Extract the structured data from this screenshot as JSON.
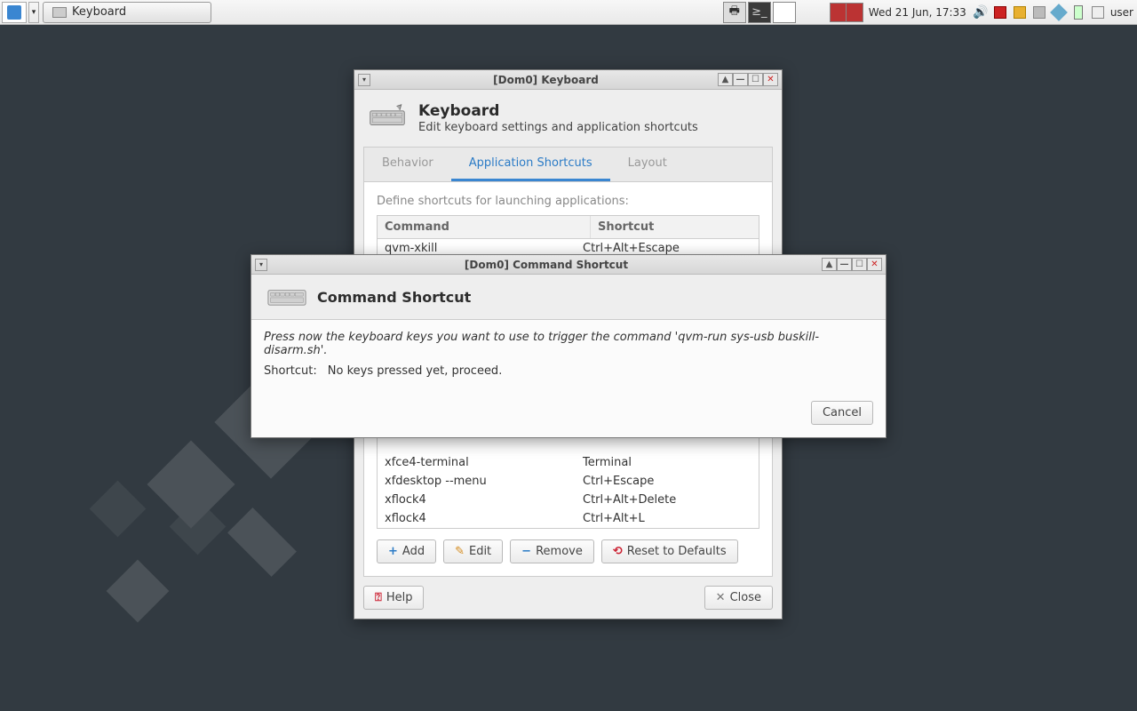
{
  "taskbar": {
    "task_label": "Keyboard",
    "clock": "Wed 21 Jun, 17:33",
    "username": "user"
  },
  "kbd_window": {
    "title": "[Dom0] Keyboard",
    "header_title": "Keyboard",
    "header_sub": "Edit keyboard settings and application shortcuts",
    "tabs": {
      "behavior": "Behavior",
      "app_shortcuts": "Application Shortcuts",
      "layout": "Layout"
    },
    "intro": "Define shortcuts for launching applications:",
    "th_command": "Command",
    "th_shortcut": "Shortcut",
    "rows_top": [
      {
        "cmd": "qvm-xkill",
        "sh": "Ctrl+Alt+Escape"
      }
    ],
    "rows_bottom": [
      {
        "cmd": "xfce4-terminal",
        "sh": "Terminal"
      },
      {
        "cmd": "xfdesktop --menu",
        "sh": "Ctrl+Escape"
      },
      {
        "cmd": "xflock4",
        "sh": "Ctrl+Alt+Delete"
      },
      {
        "cmd": "xflock4",
        "sh": "Ctrl+Alt+L"
      }
    ],
    "buttons": {
      "add": "Add",
      "edit": "Edit",
      "remove": "Remove",
      "reset": "Reset to Defaults",
      "help": "Help",
      "close": "Close"
    }
  },
  "dialog": {
    "title": "[Dom0] Command Shortcut",
    "header": "Command Shortcut",
    "instruction_pre": "Press now the keyboard keys you want to use to trigger the command '",
    "instruction_cmd": "qvm-run sys-usb buskill-disarm.sh",
    "instruction_post": "'.",
    "shortcut_label": "Shortcut:",
    "shortcut_value": "No keys pressed yet, proceed.",
    "cancel": "Cancel"
  }
}
